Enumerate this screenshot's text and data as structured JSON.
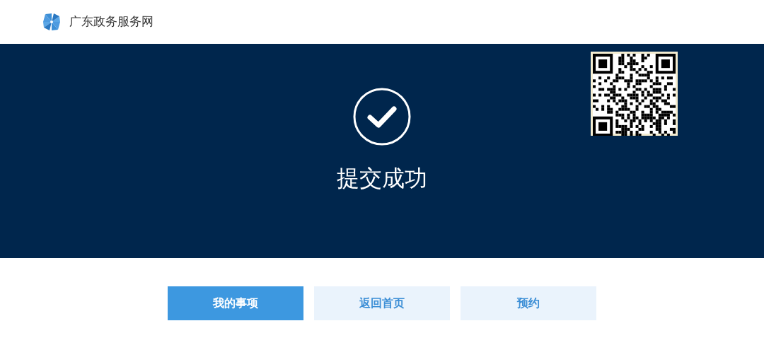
{
  "header": {
    "site_name": "广东政务服务网"
  },
  "banner": {
    "title": "提交成功"
  },
  "buttons": [
    {
      "label": "我的事项",
      "kind": "primary"
    },
    {
      "label": "返回首页",
      "kind": "secondary"
    },
    {
      "label": "预约",
      "kind": "secondary"
    }
  ]
}
